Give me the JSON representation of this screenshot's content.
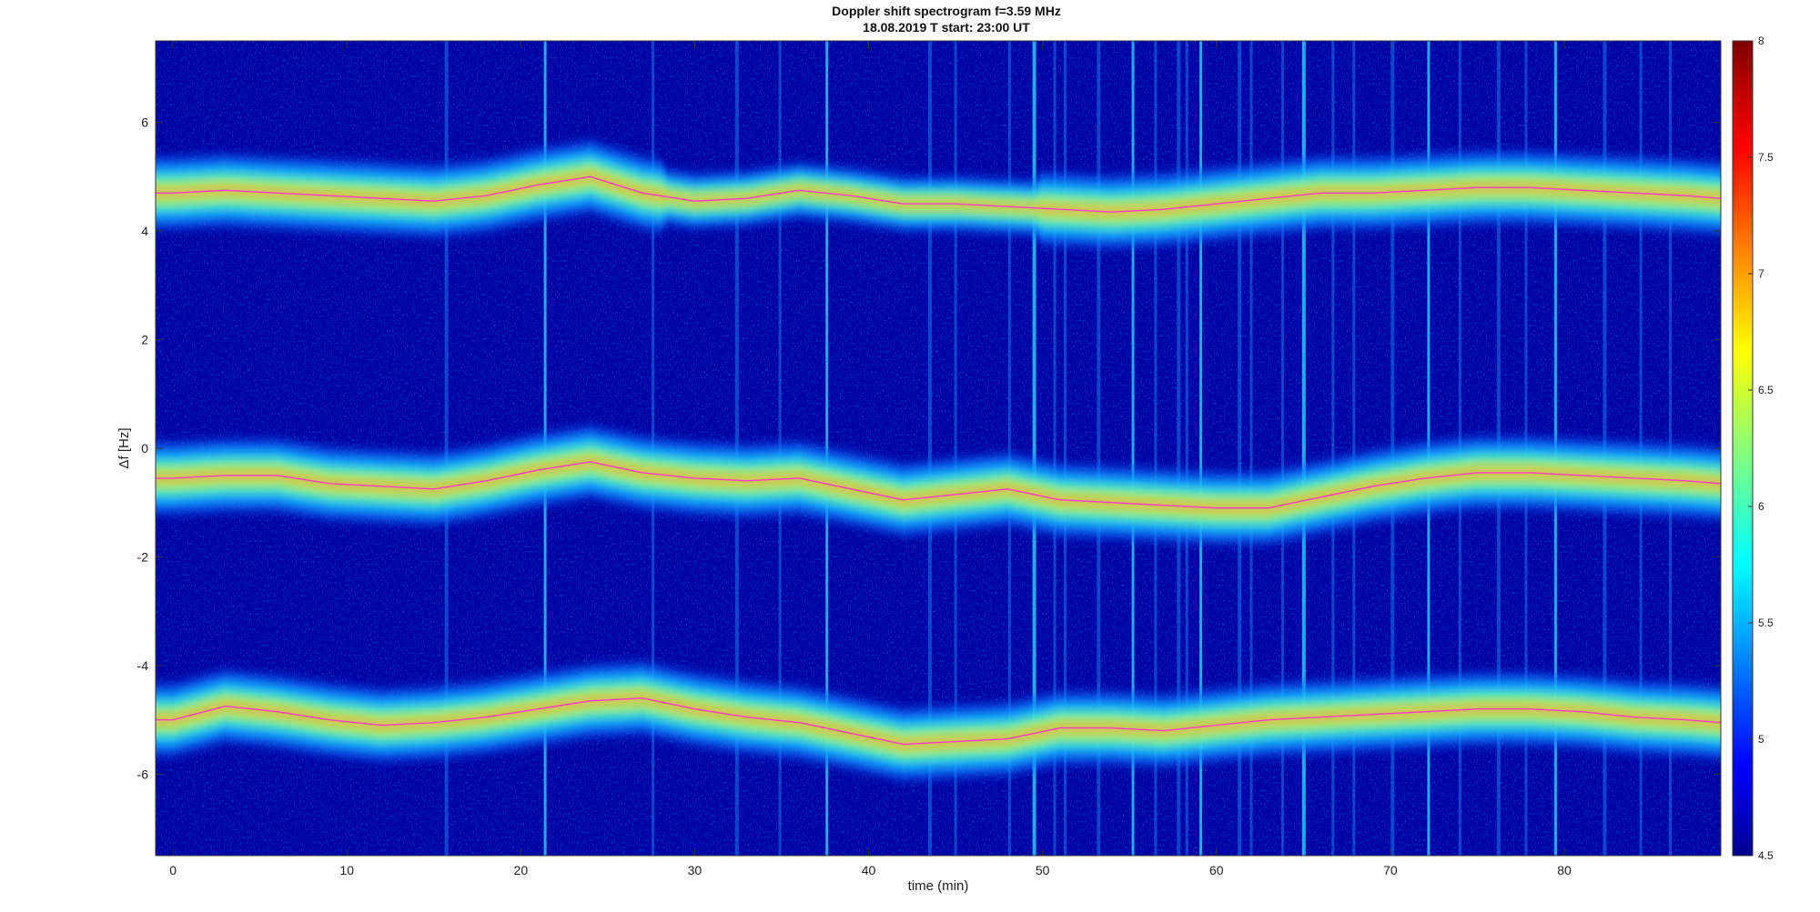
{
  "chart_data": {
    "type": "heatmap",
    "title": "Doppler shift spectrogram f=3.59 MHz",
    "subtitle": "18.08.2019    T start: 23:00 UT",
    "xlabel": "time (min)",
    "ylabel": "Δf [Hz]",
    "xlim": [
      -1,
      89
    ],
    "ylim": [
      -7.5,
      7.5
    ],
    "x_ticks": [
      0,
      10,
      20,
      30,
      40,
      50,
      60,
      70,
      80
    ],
    "y_ticks": [
      -6,
      -4,
      -2,
      0,
      2,
      4,
      6
    ],
    "colorbar": {
      "colormap": "jet",
      "range": [
        4.5,
        8
      ],
      "ticks": [
        4.5,
        5,
        5.5,
        6,
        6.5,
        7,
        7.5,
        8
      ]
    },
    "grid": false,
    "series": [
      {
        "x": [
          0,
          3,
          6,
          9,
          12,
          15,
          18,
          21,
          24,
          27,
          30,
          33,
          36,
          39,
          42,
          45,
          48,
          51,
          54,
          57,
          60,
          63,
          66,
          69,
          72,
          75,
          78,
          81,
          84,
          87,
          89
        ],
        "y": [
          4.7,
          4.75,
          4.7,
          4.65,
          4.6,
          4.55,
          4.65,
          4.85,
          5.0,
          4.7,
          4.55,
          4.6,
          4.75,
          4.65,
          4.5,
          4.5,
          4.45,
          4.4,
          4.35,
          4.4,
          4.5,
          4.6,
          4.7,
          4.7,
          4.75,
          4.8,
          4.8,
          4.75,
          4.7,
          4.65,
          4.6
        ]
      },
      {
        "x": [
          0,
          3,
          6,
          9,
          12,
          15,
          18,
          21,
          24,
          27,
          30,
          33,
          36,
          39,
          42,
          45,
          48,
          51,
          54,
          57,
          60,
          63,
          66,
          69,
          72,
          75,
          78,
          81,
          84,
          87,
          89
        ],
        "y": [
          -0.55,
          -0.5,
          -0.5,
          -0.65,
          -0.7,
          -0.75,
          -0.6,
          -0.4,
          -0.25,
          -0.45,
          -0.55,
          -0.6,
          -0.55,
          -0.75,
          -0.95,
          -0.85,
          -0.75,
          -0.95,
          -1.0,
          -1.05,
          -1.1,
          -1.1,
          -0.9,
          -0.7,
          -0.55,
          -0.45,
          -0.45,
          -0.5,
          -0.55,
          -0.6,
          -0.65
        ]
      },
      {
        "x": [
          0,
          3,
          6,
          9,
          12,
          15,
          18,
          21,
          24,
          27,
          30,
          33,
          36,
          39,
          42,
          45,
          48,
          51,
          54,
          57,
          60,
          63,
          66,
          69,
          72,
          75,
          78,
          81,
          84,
          87,
          89
        ],
        "y": [
          -5.0,
          -4.75,
          -4.85,
          -5.0,
          -5.1,
          -5.05,
          -4.95,
          -4.8,
          -4.65,
          -4.6,
          -4.8,
          -4.95,
          -5.05,
          -5.25,
          -5.45,
          -5.4,
          -5.35,
          -5.15,
          -5.15,
          -5.2,
          -5.1,
          -5.0,
          -4.95,
          -4.9,
          -4.85,
          -4.8,
          -4.8,
          -4.85,
          -4.95,
          -5.0,
          -5.05
        ]
      }
    ],
    "vertical_streaks_x": [
      15.7,
      21.4,
      27.6,
      32.4,
      34.9,
      37.6,
      43.5,
      45.0,
      48.1,
      49.5,
      50.7,
      51.3,
      53.2,
      55.2,
      56.5,
      57.8,
      58.3,
      59.1,
      61.3,
      62.0,
      63.8,
      65.0,
      66.7,
      67.9,
      70.1,
      72.2,
      74.0,
      76.2,
      77.8,
      79.5,
      82.3,
      84.4,
      86.1
    ]
  }
}
